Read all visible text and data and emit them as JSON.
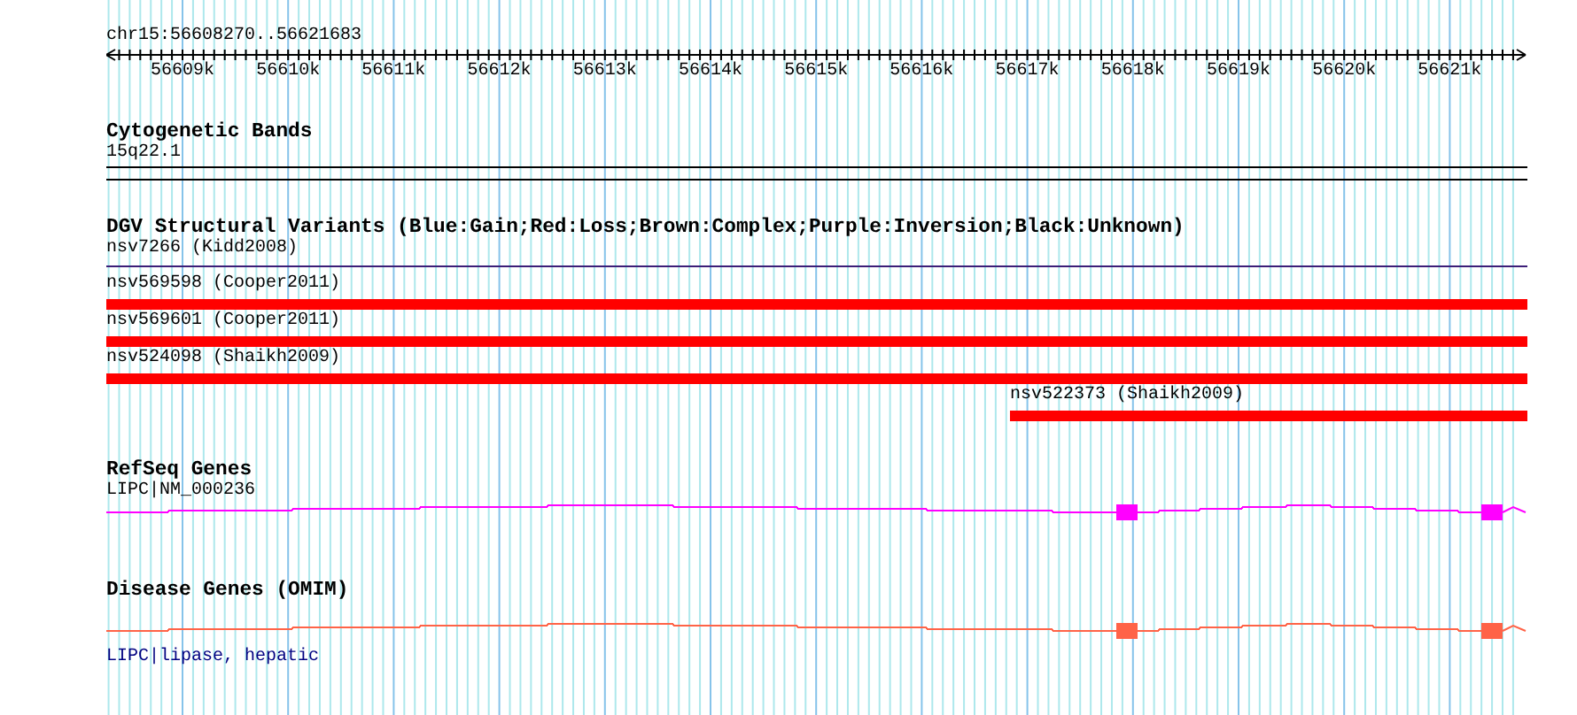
{
  "ruler": {
    "range": "chr15:56608270..56621683",
    "ticks": [
      "56609k",
      "56610k",
      "56611k",
      "56612k",
      "56613k",
      "56614k",
      "56615k",
      "56616k",
      "56617k",
      "56618k",
      "56619k",
      "56620k",
      "56621k"
    ]
  },
  "tracks": [
    {
      "kind": "bands",
      "title": "Cytogenetic Bands",
      "features": [
        {
          "label": "15q22.1"
        }
      ]
    },
    {
      "kind": "variants",
      "title": "DGV Structural Variants (Blue:Gain;Red:Loss;Brown:Complex;Purple:Inversion;Black:Unknown)",
      "features": [
        {
          "label": "nsv7266 (Kidd2008)",
          "kind": "line",
          "color": "#3c1e78"
        },
        {
          "label": "nsv569598 (Cooper2011)",
          "kind": "bar",
          "color": "#ff0000"
        },
        {
          "label": "nsv569601 (Cooper2011)",
          "kind": "bar",
          "color": "#ff0000"
        },
        {
          "label": "nsv524098 (Shaikh2009)",
          "kind": "bar",
          "color": "#ff0000"
        },
        {
          "label": "nsv522373 (Shaikh2009)",
          "kind": "bar",
          "color": "#ff0000"
        }
      ]
    },
    {
      "kind": "gene",
      "title": "RefSeq Genes",
      "features": [
        {
          "label": "LIPC|NM_000236",
          "color": "#ff00ff",
          "link": false
        }
      ]
    },
    {
      "kind": "disease",
      "title": "Disease Genes (OMIM)",
      "features": [
        {
          "label": "LIPC|lipase, hepatic",
          "color": "#ff6347",
          "link": true
        }
      ]
    }
  ]
}
